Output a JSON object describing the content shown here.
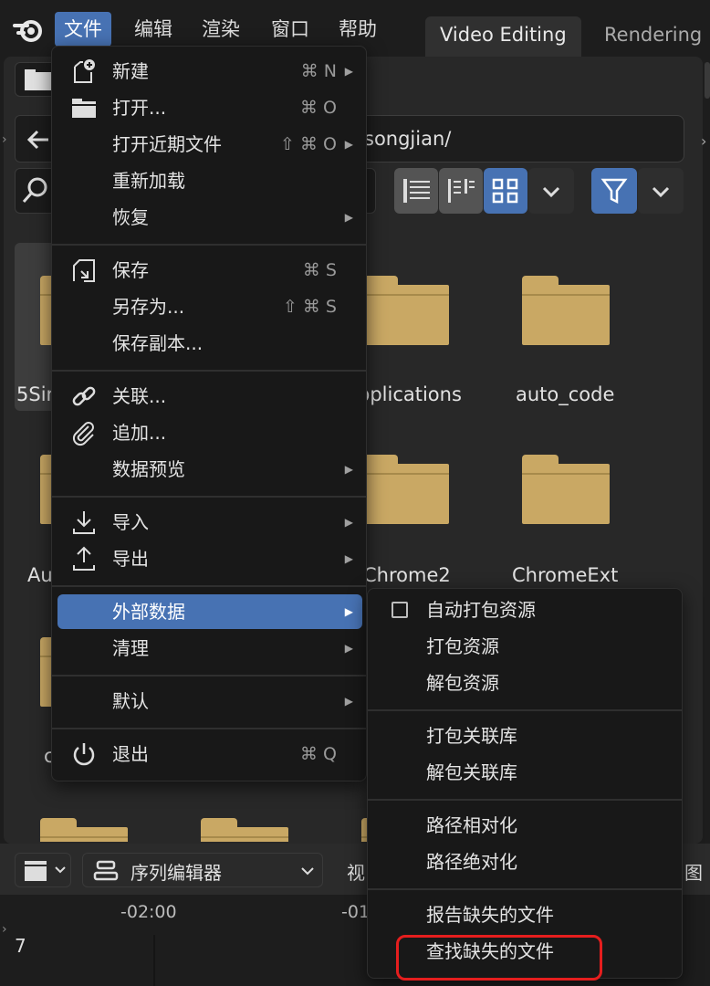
{
  "menubar": {
    "items": [
      {
        "label": "文件",
        "active": true
      },
      {
        "label": "编辑"
      },
      {
        "label": "渲染"
      },
      {
        "label": "窗口"
      },
      {
        "label": "帮助"
      }
    ],
    "workspaces": [
      {
        "label": "Video Editing",
        "active": true
      },
      {
        "label": "Rendering"
      }
    ]
  },
  "file_browser": {
    "path": "songjian/",
    "folders": [
      {
        "label": "5Sin"
      },
      {
        "label": "pplications"
      },
      {
        "label": "auto_code"
      },
      {
        "label": "Au"
      },
      {
        "label": "Chrome2"
      },
      {
        "label": "ChromeExt"
      },
      {
        "label": "c"
      }
    ]
  },
  "file_menu": {
    "items": [
      {
        "label": "新建",
        "shortcut": "⌘ N",
        "submenu": true,
        "icon": "new-file-icon"
      },
      {
        "label": "打开...",
        "shortcut": "⌘ O",
        "icon": "folder-open-icon"
      },
      {
        "label": "打开近期文件",
        "shortcut": "⇧ ⌘ O",
        "submenu": true
      },
      {
        "label": "重新加载"
      },
      {
        "label": "恢复",
        "submenu": true
      },
      {
        "label": "保存",
        "shortcut": "⌘ S",
        "icon": "save-icon"
      },
      {
        "label": "另存为...",
        "shortcut": "⇧ ⌘ S"
      },
      {
        "label": "保存副本..."
      },
      {
        "label": "关联...",
        "icon": "link-icon"
      },
      {
        "label": "追加...",
        "icon": "paperclip-icon"
      },
      {
        "label": "数据预览",
        "submenu": true
      },
      {
        "label": "导入",
        "submenu": true,
        "icon": "import-icon"
      },
      {
        "label": "导出",
        "submenu": true,
        "icon": "export-icon"
      },
      {
        "label": "外部数据",
        "submenu": true,
        "highlighted": true
      },
      {
        "label": "清理",
        "submenu": true
      },
      {
        "label": "默认",
        "submenu": true
      },
      {
        "label": "退出",
        "shortcut": "⌘ Q",
        "icon": "power-icon"
      }
    ]
  },
  "external_data_submenu": {
    "items": [
      {
        "label": "自动打包资源",
        "checkbox": true,
        "checked": false
      },
      {
        "label": "打包资源"
      },
      {
        "label": "解包资源"
      },
      {
        "label": "打包关联库"
      },
      {
        "label": "解包关联库"
      },
      {
        "label": "路径相对化"
      },
      {
        "label": "路径绝对化"
      },
      {
        "label": "报告缺失的文件"
      },
      {
        "label": "查找缺失的文件",
        "annotated": true
      }
    ]
  },
  "sequencer": {
    "editor_type": "序列编辑器",
    "view_label": "视",
    "right_label": "图",
    "time_marks": [
      "-02:00",
      "-01"
    ],
    "frame": "7"
  },
  "colors": {
    "accent": "#4772b3",
    "folder": "#c9a864",
    "annotation": "#e51e1e"
  }
}
